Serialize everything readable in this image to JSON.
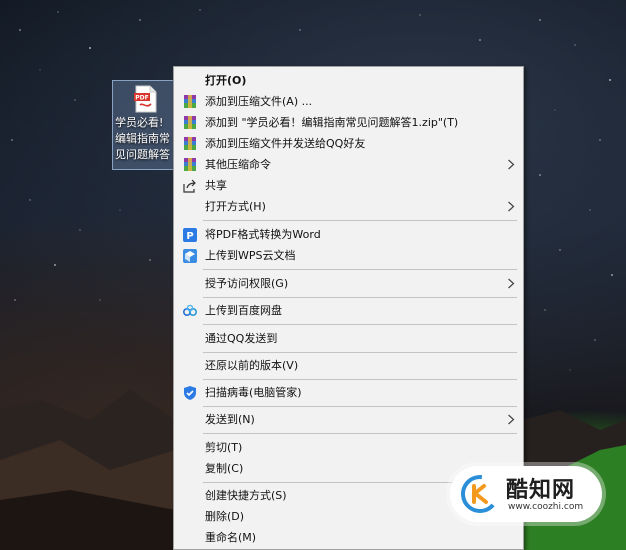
{
  "desktop_icon": {
    "badge": "PDF",
    "label_lines": [
      "学员必看!",
      "编辑指南常",
      "见问题解答"
    ]
  },
  "context_menu": {
    "items": [
      {
        "label": "打开(O)",
        "icon": "none",
        "bold": true
      },
      {
        "label": "添加到压缩文件(A) ...",
        "icon": "winrar-archive-icon"
      },
      {
        "label": "添加到 \"学员必看！编辑指南常见问题解答1.zip\"(T)",
        "icon": "winrar-archive-icon"
      },
      {
        "label": "添加到压缩文件并发送给QQ好友",
        "icon": "winrar-archive-icon"
      },
      {
        "label": "其他压缩命令",
        "icon": "winrar-archive-icon",
        "submenu": true
      },
      {
        "label": "共享",
        "icon": "share-icon"
      },
      {
        "label": "打开方式(H)",
        "icon": "none",
        "submenu": true
      },
      {
        "label": "将PDF格式转换为Word",
        "icon": "pdf-convert-icon"
      },
      {
        "label": "上传到WPS云文档",
        "icon": "wps-cloud-icon"
      },
      {
        "label": "授予访问权限(G)",
        "icon": "none",
        "submenu": true
      },
      {
        "label": "上传到百度网盘",
        "icon": "baidu-netdisk-icon"
      },
      {
        "label": "通过QQ发送到",
        "icon": "none"
      },
      {
        "label": "还原以前的版本(V)",
        "icon": "none"
      },
      {
        "label": "扫描病毒(电脑管家)",
        "icon": "tencent-pc-manager-icon"
      },
      {
        "label": "发送到(N)",
        "icon": "none",
        "submenu": true
      },
      {
        "label": "剪切(T)",
        "icon": "none"
      },
      {
        "label": "复制(C)",
        "icon": "none"
      },
      {
        "label": "创建快捷方式(S)",
        "icon": "none"
      },
      {
        "label": "删除(D)",
        "icon": "none"
      },
      {
        "label": "重命名(M)",
        "icon": "none"
      }
    ]
  },
  "watermark": {
    "name": "酷知网",
    "url": "www.coozhi.com"
  },
  "colors": {
    "menu_bg": "#f2f2f2",
    "separator": "#c4c4c4",
    "pdf_red": "#d9342b",
    "wps_blue": "#2c7be5",
    "brand_orange": "#f39a1e",
    "brand_blue": "#2a8fd8"
  }
}
